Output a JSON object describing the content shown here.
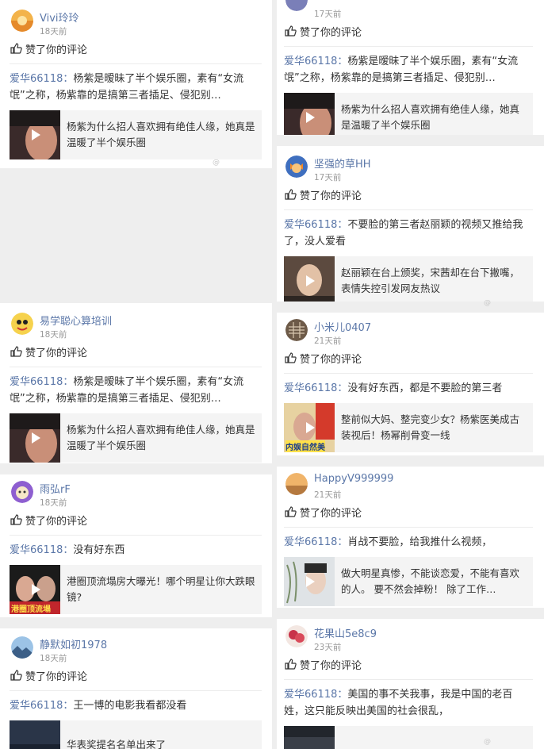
{
  "like_text": "赞了你的评论",
  "author": "爱华66118：",
  "watermark": "@",
  "left": [
    {
      "user": "Vivi玲玲",
      "time": "18天前",
      "comment": "杨紫是暧昧了半个娱乐圈，素有“女流氓”之称，杨紫靠的是搞第三者插足、侵犯别…",
      "video_title": "杨紫为什么招人喜欢拥有绝佳人缘，她真是温暖了半个娱乐圈"
    },
    {
      "user": "易学聪心算培训",
      "time": "18天前",
      "comment": "杨紫是暧昧了半个娱乐圈，素有“女流氓”之称，杨紫靠的是搞第三者插足、侵犯别…",
      "video_title": "杨紫为什么招人喜欢拥有绝佳人缘，她真是温暖了半个娱乐圈"
    },
    {
      "user": "雨弘rF",
      "time": "18天前",
      "comment": "没有好东西",
      "video_title": "港圈顶流塌房大曝光！哪个明星让你大跌眼镜?",
      "thumb_caption": "港圈顶流塌"
    },
    {
      "user": "静默如初1978",
      "time": "18天前",
      "comment": "王一博的电影我看都没看",
      "video_title": "华表奖提名名单出来了"
    }
  ],
  "right": [
    {
      "user": "",
      "time": "17天前",
      "comment": "杨紫是暧昧了半个娱乐圈，素有“女流氓”之称，杨紫靠的是搞第三者插足、侵犯别…",
      "video_title": "杨紫为什么招人喜欢拥有绝佳人缘，她真是温暖了半个娱乐圈"
    },
    {
      "user": "坚强的草HH",
      "time": "17天前",
      "comment": "不要脸的第三者赵丽颖的视频又推给我了，没人爱看",
      "video_title": "赵丽颖在台上颁奖，宋茜却在台下撇嘴，表情失控引发网友热议"
    },
    {
      "user": "小米儿0407",
      "time": "21天前",
      "comment": "没有好东西，都是不要脸的第三者",
      "video_title": "整前似大妈、整完变少女？杨紫医美成古装视后！杨幂削骨变一线",
      "thumb_caption": "内娱自然美"
    },
    {
      "user": "HappyV999999",
      "time": "21天前",
      "comment": "肖战不要脸，给我推什么视频，",
      "video_title": "做大明星真惨，不能谈恋爱，不能有喜欢的人。 要不然会掉粉！ 除了工作…"
    },
    {
      "user": "花果山5e8c9",
      "time": "23天前",
      "comment": "美国的事不关我事，我是中国的老百姓，这只能反映出美国的社会很乱，",
      "video_title": ""
    }
  ],
  "colors": {
    "link": "#5b77a8",
    "text": "#333333",
    "meta": "#9a9a9a",
    "panel": "#f4f4f4"
  },
  "icons": {
    "like": "thumbs-up-icon",
    "play": "play-icon"
  }
}
